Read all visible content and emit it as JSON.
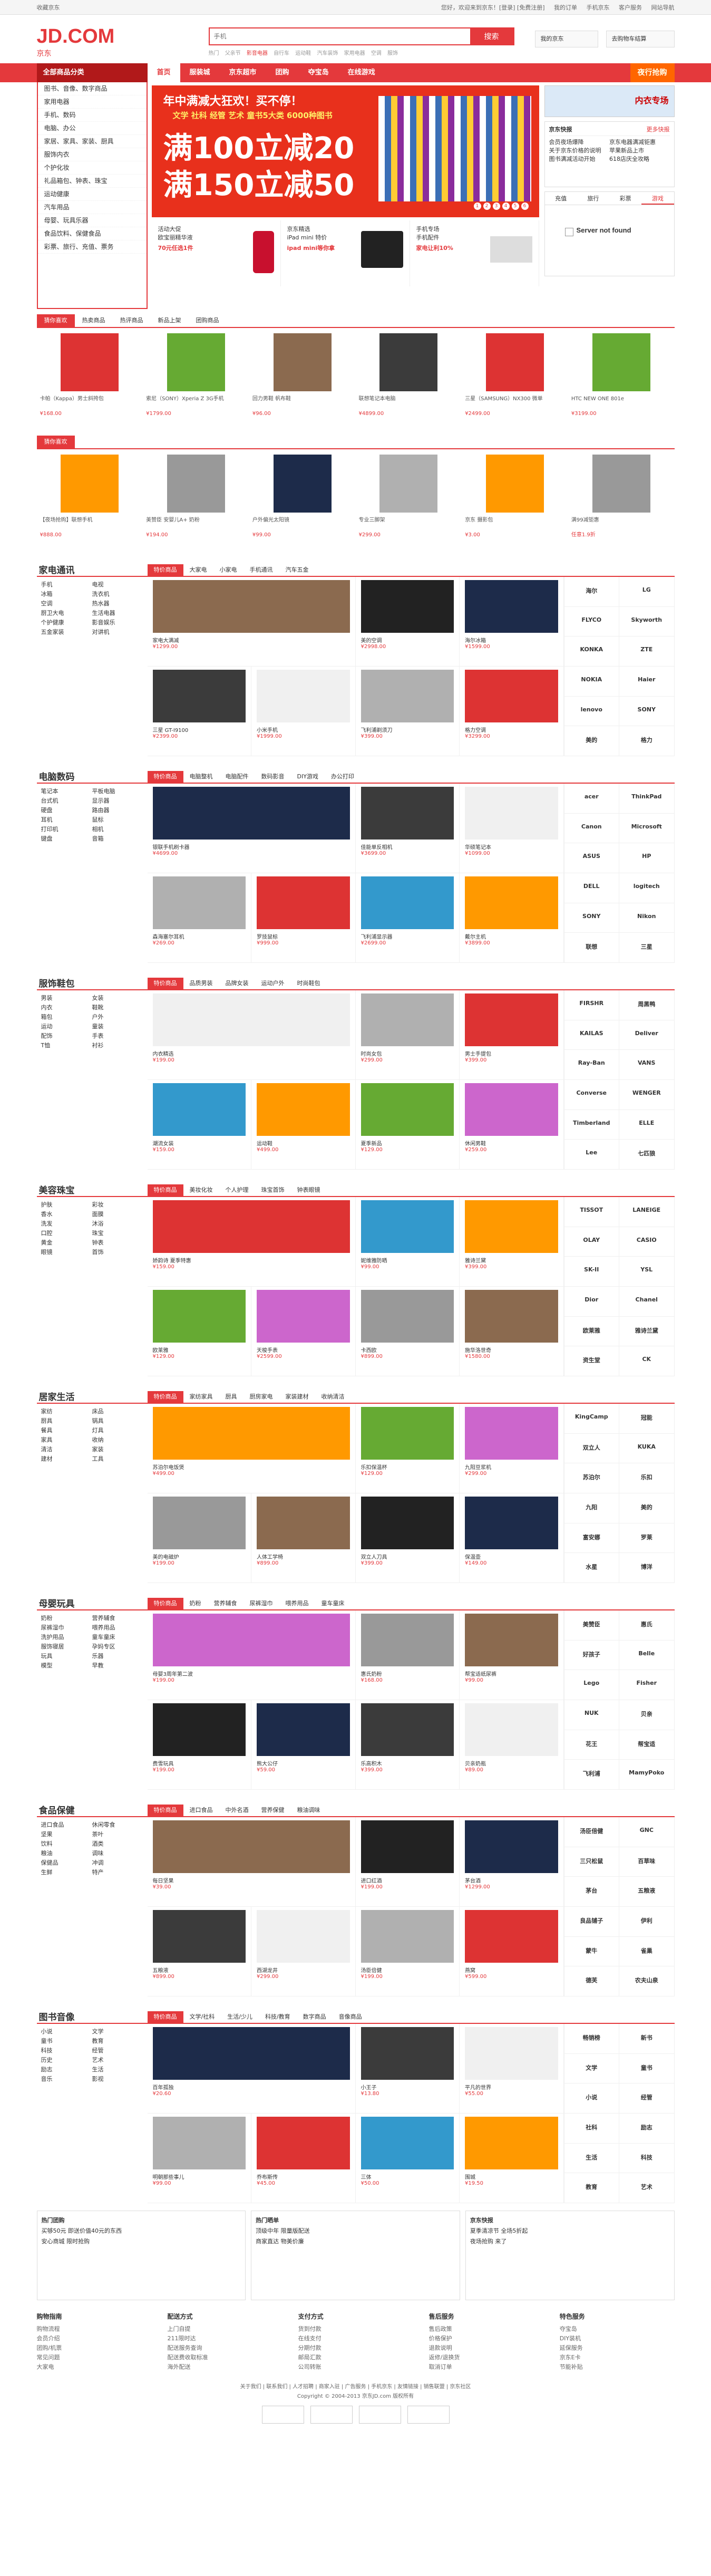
{
  "topbar": {
    "left": "收藏京东",
    "links": [
      "您好，欢迎来到京东！[登录] [免费注册]",
      "我的订单",
      "手机京东",
      "客户服务",
      "网站导航"
    ]
  },
  "logo": {
    "text": "JD.COM",
    "cn": "京东"
  },
  "search": {
    "placeholder": "手机",
    "button": "搜索",
    "hot": [
      "热门",
      "父亲节",
      "影音电器",
      "自行车",
      "运动鞋",
      "汽车装饰",
      "家用电器",
      "空调",
      "服饰"
    ]
  },
  "myjd": "我的京东",
  "cart": "去购物车结算",
  "nav": {
    "allcat": "全部商品分类",
    "items": [
      "首页",
      "服装城",
      "京东超市",
      "团购",
      "夺宝岛",
      "在线游戏"
    ],
    "promo": "夜行抢购"
  },
  "categories": [
    "图书、音像、数字商品",
    "家用电器",
    "手机、数码",
    "电脑、办公",
    "家居、家具、家装、厨具",
    "服饰内衣",
    "个护化妆",
    "礼品箱包、钟表、珠宝",
    "运动健康",
    "汽车用品",
    "母婴、玩具乐器",
    "食品饮料、保健食品",
    "彩票、旅行、充值、票务"
  ],
  "banner": {
    "t1": "年中满减大狂欢！买不停！",
    "t2": "文学 社科 经管 艺术 童书5大类 6000种图书",
    "big1": "满100立减20",
    "big2": "满150立减50",
    "dots": [
      "1",
      "2",
      "3",
      "4",
      "5",
      "6"
    ]
  },
  "sub3": [
    {
      "name": "活动大促",
      "desc": "欧宝丽精华液",
      "price": "70元任选1件"
    },
    {
      "name": "京东精选",
      "desc": "iPad mini 特价",
      "price": "ipad mini等你拿"
    },
    {
      "name": "手机专场",
      "desc": "手机配件",
      "price": "家电让利10%"
    }
  ],
  "rightad": "内衣专场",
  "news": {
    "title": "京东快报",
    "more": "更多快报",
    "items": [
      "会员夜场爆降",
      "京东电器满减钜惠",
      "关于京东价格的说明",
      "苹果新品上市",
      "图书满减活动开始",
      "618店庆全攻略"
    ]
  },
  "tabs4": [
    "充值",
    "旅行",
    "彩票",
    "游戏"
  ],
  "notfound": "Server not found",
  "hotrow": {
    "tabs": [
      "猜你喜欢",
      "热卖商品",
      "热评商品",
      "新品上架",
      "团购商品"
    ],
    "items": [
      {
        "name": "卡帕（Kappa）男士斜挎包",
        "price": "¥168.00"
      },
      {
        "name": "索尼（SONY）Xperia Z 3G手机",
        "price": "¥1799.00"
      },
      {
        "name": "回力男鞋 帆布鞋",
        "price": "¥96.00"
      },
      {
        "name": "联想笔记本电脑",
        "price": "¥4899.00"
      },
      {
        "name": "三星（SAMSUNG）NX300 微单",
        "price": "¥2499.00"
      },
      {
        "name": "HTC NEW ONE 801e",
        "price": "¥3199.00"
      }
    ]
  },
  "flashrow": {
    "items": [
      {
        "name": "【夜场抢购】联想手机",
        "price": "¥888.00"
      },
      {
        "name": "美赞臣 安婴儿A+ 奶粉",
        "price": "¥194.00"
      },
      {
        "name": "户外偏光太阳镜",
        "price": "¥99.00"
      },
      {
        "name": "专业三脚架",
        "price": "¥299.00"
      },
      {
        "name": "京东 摄影包",
        "price": "¥3.00"
      },
      {
        "name": "满99减钜惠",
        "price": "任意1.9折"
      }
    ]
  },
  "floors": [
    {
      "name": "家电通讯",
      "tabs": [
        "特价商品",
        "大家电",
        "小家电",
        "手机通讯",
        "汽车五金"
      ],
      "side": [
        "手机",
        "电视",
        "冰箱",
        "洗衣机",
        "空调",
        "热水器",
        "厨卫大电",
        "生活电器",
        "个护健康",
        "影音娱乐",
        "五金家装",
        "对讲机"
      ],
      "cells": [
        "家电大满减",
        "美的空调",
        "海尔冰箱",
        "三星 GT-I9100",
        "小米手机",
        "飞利浦剃须刀",
        "格力空调",
        "TCL电视"
      ],
      "prices": [
        "¥1299.00",
        "¥2998.00",
        "¥1599.00",
        "¥2399.00",
        "¥1999.00",
        "¥399.00",
        "¥3299.00",
        "¥2199.00"
      ],
      "brands": [
        "海尔",
        "LG",
        "FLYCO",
        "Skyworth",
        "KONKA",
        "ZTE",
        "NOKIA",
        "Haier",
        "lenovo",
        "SONY",
        "美的",
        "格力"
      ]
    },
    {
      "name": "电脑数码",
      "tabs": [
        "特价商品",
        "电脑整机",
        "电脑配件",
        "数码影音",
        "DIY游戏",
        "办公打印"
      ],
      "side": [
        "笔记本",
        "平板电脑",
        "台式机",
        "显示器",
        "硬盘",
        "路由器",
        "耳机",
        "鼠标",
        "打印机",
        "相机",
        "键盘",
        "音箱"
      ],
      "cells": [
        "银联手机刷卡器",
        "佳能单反相机",
        "华硕笔记本",
        "森海塞尔耳机",
        "罗技鼠标",
        "飞利浦显示器",
        "戴尔主机",
        "雷蛇键盘"
      ],
      "prices": [
        "¥4699.00",
        "¥3699.00",
        "¥1099.00",
        "¥269.00",
        "¥999.00",
        "¥2699.00",
        "¥3899.00",
        "¥599.00"
      ],
      "brands": [
        "acer",
        "ThinkPad",
        "Canon",
        "Microsoft",
        "ASUS",
        "HP",
        "DELL",
        "logitech",
        "SONY",
        "Nikon",
        "联想",
        "三星"
      ]
    },
    {
      "name": "服饰鞋包",
      "tabs": [
        "特价商品",
        "品质男装",
        "品牌女装",
        "运动户外",
        "时尚鞋包"
      ],
      "side": [
        "男装",
        "女装",
        "内衣",
        "鞋靴",
        "箱包",
        "户外",
        "运动",
        "童装",
        "配饰",
        "手表",
        "T恤",
        "衬衫"
      ],
      "cells": [
        "内衣精选",
        "时尚女包",
        "男士手提包",
        "潮流女装",
        "运动鞋",
        "夏季新品",
        "休闲男鞋",
        "运动上衣"
      ],
      "prices": [
        "¥199.00",
        "¥299.00",
        "¥399.00",
        "¥159.00",
        "¥499.00",
        "¥129.00",
        "¥259.00",
        "¥99.00"
      ],
      "brands": [
        "FIRSHR",
        "周黑鸭",
        "KAILAS",
        "Deliver",
        "Ray-Ban",
        "VANS",
        "Converse",
        "WENGER",
        "Timberland",
        "ELLE",
        "Lee",
        "七匹狼"
      ]
    },
    {
      "name": "美容珠宝",
      "tabs": [
        "特价商品",
        "美妆化妆",
        "个人护理",
        "珠宝首饰",
        "钟表眼镜"
      ],
      "side": [
        "护肤",
        "彩妆",
        "香水",
        "面膜",
        "洗发",
        "沐浴",
        "口腔",
        "珠宝",
        "黄金",
        "钟表",
        "眼镜",
        "首饰"
      ],
      "cells": [
        "娇韵诗 夏季特惠",
        "妮维雅防晒",
        "雅诗兰黛",
        "欧莱雅",
        "天梭手表",
        "卡西欧",
        "施华洛世奇",
        "周大福"
      ],
      "prices": [
        "¥159.00",
        "¥99.00",
        "¥399.00",
        "¥129.00",
        "¥2599.00",
        "¥899.00",
        "¥1580.00",
        "¥2180.00"
      ],
      "brands": [
        "TISSOT",
        "LANEIGE",
        "OLAY",
        "CASIO",
        "SK-II",
        "YSL",
        "Dior",
        "Chanel",
        "欧莱雅",
        "雅诗兰黛",
        "资生堂",
        "CK"
      ]
    },
    {
      "name": "居家生活",
      "tabs": [
        "特价商品",
        "家纺家具",
        "厨具",
        "厨房家电",
        "家装建材",
        "收纳清洁"
      ],
      "side": [
        "家纺",
        "床品",
        "厨具",
        "锅具",
        "餐具",
        "灯具",
        "家具",
        "收纳",
        "清洁",
        "家装",
        "建材",
        "工具"
      ],
      "cells": [
        "苏泊尔电饭煲",
        "乐扣保温杯",
        "九阳豆浆机",
        "美的电磁炉",
        "人体工学椅",
        "双立人刀具",
        "保温壶",
        "七月精选"
      ],
      "prices": [
        "¥499.00",
        "¥129.00",
        "¥299.00",
        "¥199.00",
        "¥899.00",
        "¥399.00",
        "¥149.00",
        "¥229.00"
      ],
      "brands": [
        "KingCamp",
        "冠能",
        "双立人",
        "KUKA",
        "苏泊尔",
        "乐扣",
        "九阳",
        "美的",
        "富安娜",
        "罗莱",
        "水星",
        "博洋"
      ]
    },
    {
      "name": "母婴玩具",
      "tabs": [
        "特价商品",
        "奶粉",
        "营养辅食",
        "尿裤湿巾",
        "喂养用品",
        "童车童床"
      ],
      "side": [
        "奶粉",
        "营养辅食",
        "尿裤湿巾",
        "喂养用品",
        "洗护用品",
        "童车童床",
        "服饰寝居",
        "孕妈专区",
        "玩具",
        "乐器",
        "模型",
        "早教"
      ],
      "cells": [
        "母婴3周年第二波",
        "惠氏奶粉",
        "帮宝适纸尿裤",
        "费雪玩具",
        "熊大公仔",
        "乐高积木",
        "贝亲奶瓶",
        "好孩子童车"
      ],
      "prices": [
        "¥199.00",
        "¥168.00",
        "¥99.00",
        "¥199.00",
        "¥59.00",
        "¥399.00",
        "¥89.00",
        "¥699.00"
      ],
      "brands": [
        "美赞臣",
        "惠氏",
        "好孩子",
        "Belle",
        "Lego",
        "Fisher",
        "NUK",
        "贝亲",
        "花王",
        "帮宝适",
        "飞利浦",
        "MamyPoko"
      ]
    },
    {
      "name": "食品保健",
      "tabs": [
        "特价商品",
        "进口食品",
        "中外名酒",
        "营养保健",
        "粮油调味"
      ],
      "side": [
        "进口食品",
        "休闲零食",
        "坚果",
        "茶叶",
        "饮料",
        "酒类",
        "粮油",
        "调味",
        "保健品",
        "冲调",
        "生鲜",
        "特产"
      ],
      "cells": [
        "每日坚果",
        "进口红酒",
        "茅台酒",
        "五粮液",
        "西湖龙井",
        "汤臣倍健",
        "燕窝",
        "蜂蜜"
      ],
      "prices": [
        "¥39.00",
        "¥199.00",
        "¥1299.00",
        "¥899.00",
        "¥299.00",
        "¥199.00",
        "¥599.00",
        "¥59.00"
      ],
      "brands": [
        "汤臣倍健",
        "GNC",
        "三只松鼠",
        "百草味",
        "茅台",
        "五粮液",
        "良品铺子",
        "伊利",
        "蒙牛",
        "雀巢",
        "德芙",
        "农夫山泉"
      ]
    },
    {
      "name": "图书音像",
      "tabs": [
        "特价商品",
        "文学/社科",
        "生活/少儿",
        "科技/教育",
        "数字商品",
        "音像商品"
      ],
      "side": [
        "小说",
        "文学",
        "童书",
        "教育",
        "科技",
        "经管",
        "历史",
        "艺术",
        "励志",
        "生活",
        "音乐",
        "影视"
      ],
      "cells": [
        "百年孤独",
        "小王子",
        "平凡的世界",
        "明朝那些事儿",
        "乔布斯传",
        "三体",
        "围城",
        "活着"
      ],
      "prices": [
        "¥20.60",
        "¥13.80",
        "¥55.00",
        "¥99.00",
        "¥45.00",
        "¥50.00",
        "¥19.50",
        "¥14.00"
      ],
      "brands": [
        "畅销榜",
        "新书",
        "文学",
        "童书",
        "小说",
        "经管",
        "社科",
        "励志",
        "生活",
        "科技",
        "教育",
        "艺术"
      ]
    }
  ],
  "bottomboxes": [
    {
      "title": "热门团购",
      "lines": [
        "买够50元 即送价值40元的东西",
        "安心商城 限时抢购"
      ]
    },
    {
      "title": "热门晒单",
      "lines": [
        "顶级中年 限量版配送",
        "商家直达 物美价廉"
      ]
    },
    {
      "title": "京东快报",
      "lines": [
        "夏季清凉节 全场5折起",
        "夜场抢购 来了"
      ]
    }
  ],
  "footcols": [
    {
      "h": "购物指南",
      "items": [
        "购物流程",
        "会员介绍",
        "团购/机票",
        "常见问题",
        "大家电"
      ]
    },
    {
      "h": "配送方式",
      "items": [
        "上门自提",
        "211限时达",
        "配送服务查询",
        "配送费收取标准",
        "海外配送"
      ]
    },
    {
      "h": "支付方式",
      "items": [
        "货到付款",
        "在线支付",
        "分期付款",
        "邮局汇款",
        "公司转账"
      ]
    },
    {
      "h": "售后服务",
      "items": [
        "售后政策",
        "价格保护",
        "退款说明",
        "返修/退换货",
        "取消订单"
      ]
    },
    {
      "h": "特色服务",
      "items": [
        "夺宝岛",
        "DIY装机",
        "延保服务",
        "京东E卡",
        "节能补贴"
      ]
    }
  ],
  "footer": {
    "links": "关于我们 | 联系我们 | 人才招聘 | 商家入驻 | 广告服务 | 手机京东 | 友情链接 | 销售联盟 | 京东社区",
    "copy": "Copyright © 2004-2013 京东JD.com 版权所有"
  }
}
